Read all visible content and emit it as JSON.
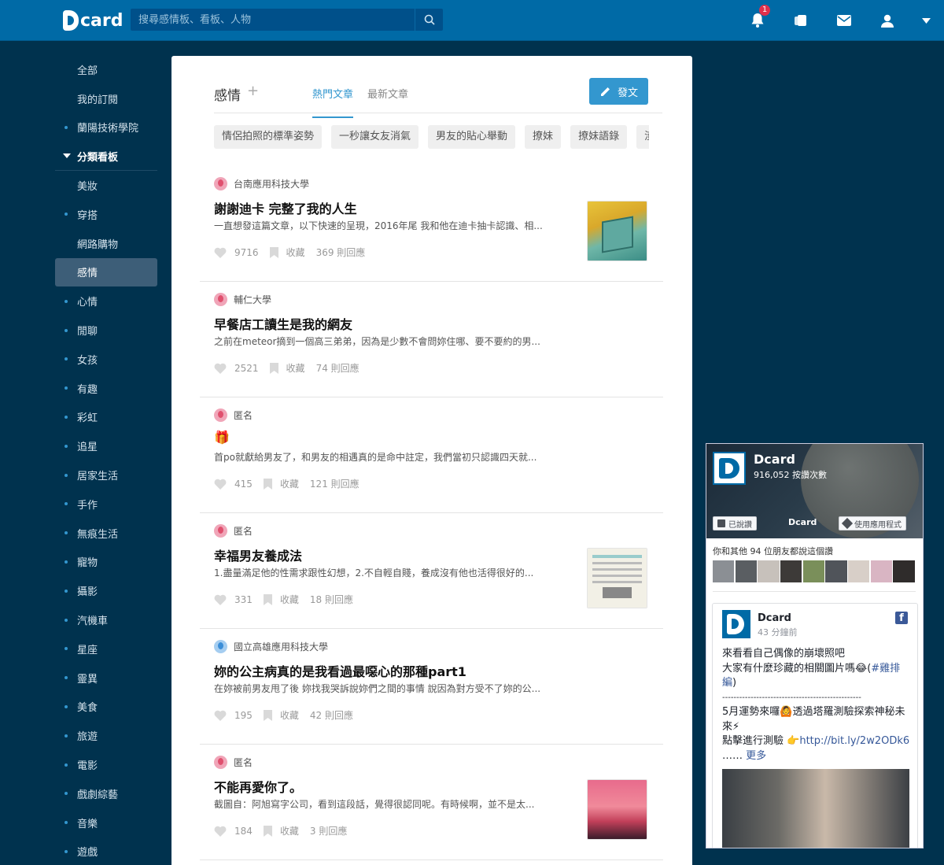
{
  "header": {
    "logo_text": "card",
    "search_placeholder": "搜尋感情板、看板、人物",
    "notification_count": "1"
  },
  "sidebar": {
    "items": [
      {
        "label": "全部",
        "dot": false
      },
      {
        "label": "我的訂閱",
        "dot": false
      },
      {
        "label": "蘭陽技術學院",
        "dot": true
      }
    ],
    "section_label": "分類看板",
    "boards": [
      {
        "label": "美妝",
        "dot": false
      },
      {
        "label": "穿搭",
        "dot": true
      },
      {
        "label": "網路購物",
        "dot": false
      },
      {
        "label": "感情",
        "dot": false,
        "active": true
      },
      {
        "label": "心情",
        "dot": true
      },
      {
        "label": "閒聊",
        "dot": true
      },
      {
        "label": "女孩",
        "dot": true
      },
      {
        "label": "有趣",
        "dot": true
      },
      {
        "label": "彩虹",
        "dot": true
      },
      {
        "label": "追星",
        "dot": true
      },
      {
        "label": "居家生活",
        "dot": true
      },
      {
        "label": "手作",
        "dot": true
      },
      {
        "label": "無痕生活",
        "dot": true
      },
      {
        "label": "寵物",
        "dot": true
      },
      {
        "label": "攝影",
        "dot": true
      },
      {
        "label": "汽機車",
        "dot": true
      },
      {
        "label": "星座",
        "dot": true
      },
      {
        "label": "靈異",
        "dot": true
      },
      {
        "label": "美食",
        "dot": true
      },
      {
        "label": "旅遊",
        "dot": true
      },
      {
        "label": "電影",
        "dot": true
      },
      {
        "label": "戲劇綜藝",
        "dot": true
      },
      {
        "label": "音樂",
        "dot": true
      },
      {
        "label": "遊戲",
        "dot": true
      }
    ]
  },
  "main": {
    "board_title": "感情",
    "plus": "+",
    "tabs": [
      "熱門文章",
      "最新文章"
    ],
    "post_button": "發文",
    "tags": [
      "情侶拍照的標準姿勢",
      "一秒讓女友消氣",
      "男友的貼心舉動",
      "撩妹",
      "撩妹語錄",
      "渣"
    ]
  },
  "posts": [
    {
      "forum": "台南應用科技大學",
      "avatar": "f",
      "title": "謝謝迪卡 完整了我的人生",
      "excerpt": "一直想發這篇文章，以下快速的呈現，2016年尾 我和他在迪卡抽卡認識、相...",
      "likes": "9716",
      "save": "收藏",
      "replies": "369 則回應",
      "thumb": "box"
    },
    {
      "forum": "輔仁大學",
      "avatar": "f",
      "title": "早餐店工讀生是我的網友",
      "excerpt": "之前在meteor摘到一個高三弟弟，因為是少數不會問妳住哪、要不要約的男...",
      "likes": "2521",
      "save": "收藏",
      "replies": "74 則回應",
      "thumb": ""
    },
    {
      "forum": "匿名",
      "avatar": "f",
      "title": "🎁",
      "excerpt": "首po就獻給男友了，和男友的相遇真的是命中註定，我們當初只認識四天就...",
      "likes": "415",
      "save": "收藏",
      "replies": "121 則回應",
      "thumb": ""
    },
    {
      "forum": "匿名",
      "avatar": "f",
      "title": "幸福男友養成法",
      "excerpt": "1.盡量滿足他的性需求跟性幻想，2.不自輕自賤，養成沒有他也活得很好的...",
      "likes": "331",
      "save": "收藏",
      "replies": "18 則回應",
      "thumb": "paper"
    },
    {
      "forum": "國立高雄應用科技大學",
      "avatar": "m",
      "title": "妳的公主病真的是我看過最噁心的那種part1",
      "excerpt": "在妳被前男友甩了後 妳找我哭訴說妳們之間的事情 說因為對方受不了妳的公...",
      "likes": "195",
      "save": "收藏",
      "replies": "42 則回應",
      "thumb": ""
    },
    {
      "forum": "匿名",
      "avatar": "f",
      "title": "不能再愛你了。",
      "excerpt": "截圖自：阿旭寫字公司，看到這段話，覺得很認同呢。有時候啊，並不是太...",
      "likes": "184",
      "save": "收藏",
      "replies": "3 則回應",
      "thumb": "sunset"
    }
  ],
  "facebook": {
    "page_name": "Dcard",
    "likes_count": "916,052 按讚次數",
    "liked_button": "已說讚",
    "app_button": "使用應用程式",
    "cover_brand": "Dcard",
    "friends_text": "你和其他 94 位朋友都說這個讚",
    "post_name": "Dcard",
    "post_time": "43 分鐘前",
    "post_line1": "來看看自己偶像的崩壞照吧",
    "post_line2": "大家有什麼珍藏的相關圖片嗎😂(",
    "post_hashtag": "#雞排編",
    "post_line2_end": ")",
    "post_divider": "-------------------------------------------------",
    "post_line3": "5月運勢來囉🙆透過塔羅測驗探索神秘未來⚡",
    "post_line4": "點擊進行測驗 👉",
    "post_url": "http://bit.ly/2w2ODk6",
    "post_more_prefix": "…… ",
    "post_more": "更多"
  }
}
